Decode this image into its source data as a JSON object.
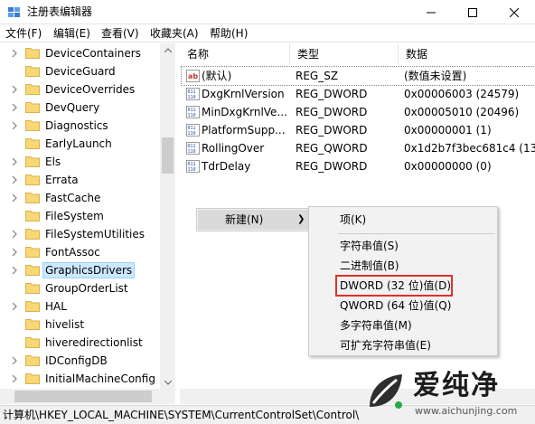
{
  "window": {
    "title": "注册表编辑器"
  },
  "menu": [
    "文件(F)",
    "编辑(E)",
    "查看(V)",
    "收藏夹(A)",
    "帮助(H)"
  ],
  "tree": {
    "items": [
      {
        "label": "DeviceContainers",
        "expandable": true
      },
      {
        "label": "DeviceGuard",
        "expandable": false
      },
      {
        "label": "DeviceOverrides",
        "expandable": true
      },
      {
        "label": "DevQuery",
        "expandable": true
      },
      {
        "label": "Diagnostics",
        "expandable": true
      },
      {
        "label": "EarlyLaunch",
        "expandable": false
      },
      {
        "label": "Els",
        "expandable": true
      },
      {
        "label": "Errata",
        "expandable": true
      },
      {
        "label": "FastCache",
        "expandable": true
      },
      {
        "label": "FileSystem",
        "expandable": false
      },
      {
        "label": "FileSystemUtilities",
        "expandable": true
      },
      {
        "label": "FontAssoc",
        "expandable": true
      },
      {
        "label": "GraphicsDrivers",
        "expandable": true,
        "selected": true
      },
      {
        "label": "GroupOrderList",
        "expandable": false
      },
      {
        "label": "HAL",
        "expandable": true
      },
      {
        "label": "hivelist",
        "expandable": false
      },
      {
        "label": "hiveredirectionlist",
        "expandable": false
      },
      {
        "label": "IDConfigDB",
        "expandable": true
      },
      {
        "label": "InitialMachineConfig",
        "expandable": true
      }
    ]
  },
  "list": {
    "headers": [
      "名称",
      "类型",
      "数据"
    ],
    "rows": [
      {
        "icon": "string-value-icon",
        "name": "(默认)",
        "type": "REG_SZ",
        "data": "(数值未设置)"
      },
      {
        "icon": "binary-value-icon",
        "name": "DxgKrnlVersion",
        "type": "REG_DWORD",
        "data": "0x00006003 (24579)"
      },
      {
        "icon": "binary-value-icon",
        "name": "MinDxgKrnlVe...",
        "type": "REG_DWORD",
        "data": "0x00005010 (20496)"
      },
      {
        "icon": "binary-value-icon",
        "name": "PlatformSupp...",
        "type": "REG_DWORD",
        "data": "0x00000001 (1)"
      },
      {
        "icon": "binary-value-icon",
        "name": "RollingOver",
        "type": "REG_QWORD",
        "data": "0x1d2b7f3bec681c4 (131"
      },
      {
        "icon": "binary-value-icon",
        "name": "TdrDelay",
        "type": "REG_DWORD",
        "data": "0x00000000 (0)"
      }
    ]
  },
  "context_menu": {
    "new_label": "新建(N)",
    "submenu": {
      "key": "项(K)",
      "items": [
        "字符串值(S)",
        "二进制值(B)",
        "DWORD (32 位)值(D)",
        "QWORD (64 位)值(Q)",
        "多字符串值(M)",
        "可扩充字符串值(E)"
      ],
      "highlighted_index": 2,
      "highlight_color": "#e0302a"
    }
  },
  "statusbar": {
    "path": "计算机\\HKEY_LOCAL_MACHINE\\SYSTEM\\CurrentControlSet\\Control\\"
  },
  "watermark": {
    "brand": "爱纯净",
    "url": "www.aichunjing.com"
  },
  "colors": {
    "folder": "#f8d775",
    "selection": "#cce8ff",
    "accent_red": "#e0302a"
  }
}
